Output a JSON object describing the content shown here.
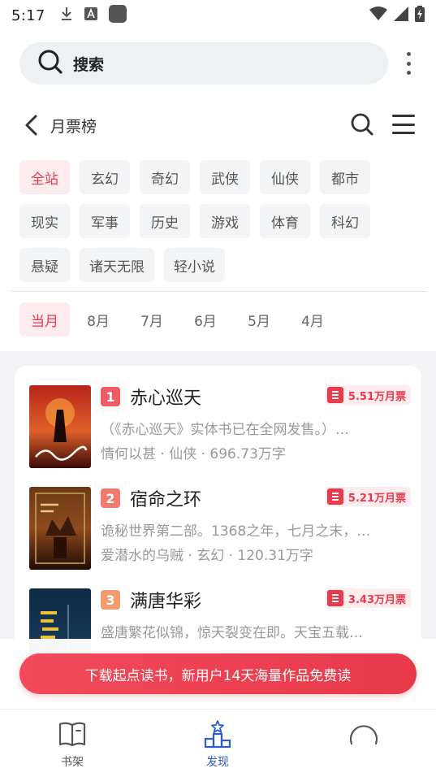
{
  "status_bar": {
    "time": "5:17"
  },
  "search": {
    "placeholder": "搜索"
  },
  "header": {
    "title": "月票榜"
  },
  "categories": [
    [
      "全站",
      "玄幻",
      "奇幻",
      "武侠",
      "仙侠",
      "都市"
    ],
    [
      "现实",
      "军事",
      "历史",
      "游戏",
      "体育",
      "科幻"
    ],
    [
      "悬疑",
      "诸天无限",
      "轻小说"
    ]
  ],
  "active_category": "全站",
  "months": [
    "当月",
    "8月",
    "7月",
    "6月",
    "5月",
    "4月"
  ],
  "active_month": "当月",
  "books": [
    {
      "rank": "1",
      "title": "赤心巡天",
      "votes": "5.51万月票",
      "desc": "（《赤心巡天》实体书已在全网发售。）…",
      "meta": "情何以甚 · 仙侠 · 696.73万字"
    },
    {
      "rank": "2",
      "title": "宿命之环",
      "votes": "5.21万月票",
      "desc": "诡秘世界第二部。1368之年，七月之末，…",
      "meta": "爱潜水的乌贼 · 玄幻 · 120.31万字"
    },
    {
      "rank": "3",
      "title": "满唐华彩",
      "votes": "3.43万月票",
      "desc": "盛唐繁花似锦，惊天裂变在即。天宝五载…",
      "meta": ""
    }
  ],
  "banner": {
    "text": "下载起点读书，新用户14天海量作品免费读"
  },
  "bottom_nav": [
    {
      "label": "书架",
      "icon": "book-icon"
    },
    {
      "label": "发现",
      "icon": "podium-icon"
    },
    {
      "label": "",
      "icon": "profile-icon"
    }
  ],
  "colors": {
    "accent": "#ea3a4b",
    "nav_active": "#2e5cc9",
    "rank1": "#ef5a67",
    "rank2": "#f27a6d",
    "rank3": "#f49a6f"
  }
}
